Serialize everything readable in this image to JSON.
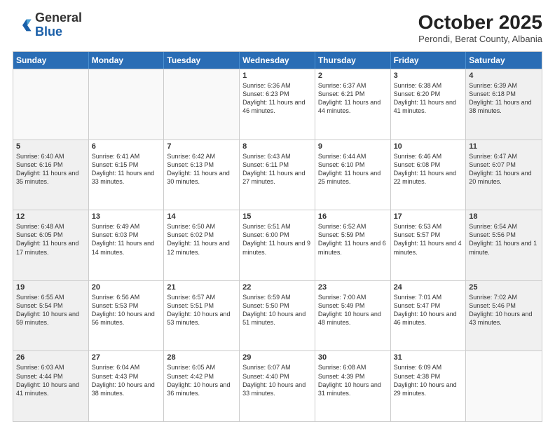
{
  "header": {
    "logo_general": "General",
    "logo_blue": "Blue",
    "title": "October 2025",
    "subtitle": "Perondi, Berat County, Albania"
  },
  "days_of_week": [
    "Sunday",
    "Monday",
    "Tuesday",
    "Wednesday",
    "Thursday",
    "Friday",
    "Saturday"
  ],
  "weeks": [
    [
      {
        "day": "",
        "info": "",
        "empty": true
      },
      {
        "day": "",
        "info": "",
        "empty": true
      },
      {
        "day": "",
        "info": "",
        "empty": true
      },
      {
        "day": "1",
        "info": "Sunrise: 6:36 AM\nSunset: 6:23 PM\nDaylight: 11 hours and 46 minutes."
      },
      {
        "day": "2",
        "info": "Sunrise: 6:37 AM\nSunset: 6:21 PM\nDaylight: 11 hours and 44 minutes."
      },
      {
        "day": "3",
        "info": "Sunrise: 6:38 AM\nSunset: 6:20 PM\nDaylight: 11 hours and 41 minutes."
      },
      {
        "day": "4",
        "info": "Sunrise: 6:39 AM\nSunset: 6:18 PM\nDaylight: 11 hours and 38 minutes.",
        "shaded": true
      }
    ],
    [
      {
        "day": "5",
        "info": "Sunrise: 6:40 AM\nSunset: 6:16 PM\nDaylight: 11 hours and 35 minutes.",
        "shaded": true
      },
      {
        "day": "6",
        "info": "Sunrise: 6:41 AM\nSunset: 6:15 PM\nDaylight: 11 hours and 33 minutes."
      },
      {
        "day": "7",
        "info": "Sunrise: 6:42 AM\nSunset: 6:13 PM\nDaylight: 11 hours and 30 minutes."
      },
      {
        "day": "8",
        "info": "Sunrise: 6:43 AM\nSunset: 6:11 PM\nDaylight: 11 hours and 27 minutes."
      },
      {
        "day": "9",
        "info": "Sunrise: 6:44 AM\nSunset: 6:10 PM\nDaylight: 11 hours and 25 minutes."
      },
      {
        "day": "10",
        "info": "Sunrise: 6:46 AM\nSunset: 6:08 PM\nDaylight: 11 hours and 22 minutes."
      },
      {
        "day": "11",
        "info": "Sunrise: 6:47 AM\nSunset: 6:07 PM\nDaylight: 11 hours and 20 minutes.",
        "shaded": true
      }
    ],
    [
      {
        "day": "12",
        "info": "Sunrise: 6:48 AM\nSunset: 6:05 PM\nDaylight: 11 hours and 17 minutes.",
        "shaded": true
      },
      {
        "day": "13",
        "info": "Sunrise: 6:49 AM\nSunset: 6:03 PM\nDaylight: 11 hours and 14 minutes."
      },
      {
        "day": "14",
        "info": "Sunrise: 6:50 AM\nSunset: 6:02 PM\nDaylight: 11 hours and 12 minutes."
      },
      {
        "day": "15",
        "info": "Sunrise: 6:51 AM\nSunset: 6:00 PM\nDaylight: 11 hours and 9 minutes."
      },
      {
        "day": "16",
        "info": "Sunrise: 6:52 AM\nSunset: 5:59 PM\nDaylight: 11 hours and 6 minutes."
      },
      {
        "day": "17",
        "info": "Sunrise: 6:53 AM\nSunset: 5:57 PM\nDaylight: 11 hours and 4 minutes."
      },
      {
        "day": "18",
        "info": "Sunrise: 6:54 AM\nSunset: 5:56 PM\nDaylight: 11 hours and 1 minute.",
        "shaded": true
      }
    ],
    [
      {
        "day": "19",
        "info": "Sunrise: 6:55 AM\nSunset: 5:54 PM\nDaylight: 10 hours and 59 minutes.",
        "shaded": true
      },
      {
        "day": "20",
        "info": "Sunrise: 6:56 AM\nSunset: 5:53 PM\nDaylight: 10 hours and 56 minutes."
      },
      {
        "day": "21",
        "info": "Sunrise: 6:57 AM\nSunset: 5:51 PM\nDaylight: 10 hours and 53 minutes."
      },
      {
        "day": "22",
        "info": "Sunrise: 6:59 AM\nSunset: 5:50 PM\nDaylight: 10 hours and 51 minutes."
      },
      {
        "day": "23",
        "info": "Sunrise: 7:00 AM\nSunset: 5:49 PM\nDaylight: 10 hours and 48 minutes."
      },
      {
        "day": "24",
        "info": "Sunrise: 7:01 AM\nSunset: 5:47 PM\nDaylight: 10 hours and 46 minutes."
      },
      {
        "day": "25",
        "info": "Sunrise: 7:02 AM\nSunset: 5:46 PM\nDaylight: 10 hours and 43 minutes.",
        "shaded": true
      }
    ],
    [
      {
        "day": "26",
        "info": "Sunrise: 6:03 AM\nSunset: 4:44 PM\nDaylight: 10 hours and 41 minutes.",
        "shaded": true
      },
      {
        "day": "27",
        "info": "Sunrise: 6:04 AM\nSunset: 4:43 PM\nDaylight: 10 hours and 38 minutes."
      },
      {
        "day": "28",
        "info": "Sunrise: 6:05 AM\nSunset: 4:42 PM\nDaylight: 10 hours and 36 minutes."
      },
      {
        "day": "29",
        "info": "Sunrise: 6:07 AM\nSunset: 4:40 PM\nDaylight: 10 hours and 33 minutes."
      },
      {
        "day": "30",
        "info": "Sunrise: 6:08 AM\nSunset: 4:39 PM\nDaylight: 10 hours and 31 minutes."
      },
      {
        "day": "31",
        "info": "Sunrise: 6:09 AM\nSunset: 4:38 PM\nDaylight: 10 hours and 29 minutes."
      },
      {
        "day": "",
        "info": "",
        "empty": true
      }
    ]
  ]
}
